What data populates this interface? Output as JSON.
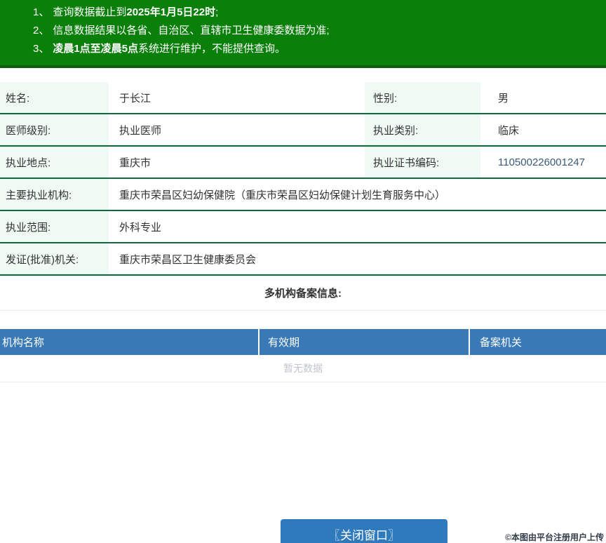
{
  "notice": {
    "items": [
      {
        "num": "1、",
        "pre": "查询数据截止到",
        "bold": "2025年1月5日22时",
        "post": ";"
      },
      {
        "num": "2、",
        "pre": "信息数据结果以各省、自治区、直辖市卫生健康委数据为准;",
        "bold": "",
        "post": ""
      },
      {
        "num": "3、",
        "pre": "",
        "bold": "凌晨1点至凌晨5点",
        "post": "系统进行维护，不能提供查询。"
      }
    ]
  },
  "info_rows": [
    {
      "l1": "姓名:",
      "v1": "于长江",
      "l2": "性别:",
      "v2": "男"
    },
    {
      "l1": "医师级别:",
      "v1": "执业医师",
      "l2": "执业类别:",
      "v2": "临床"
    },
    {
      "l1": "执业地点:",
      "v1": "重庆市",
      "l2": "执业证书编码:",
      "v2": "110500226001247"
    },
    {
      "l1": "主要执业机构:",
      "v1": "重庆市荣昌区妇幼保健院（重庆市荣昌区妇幼保健计划生育服务中心）"
    },
    {
      "l1": "执业范围:",
      "v1": "外科专业"
    },
    {
      "l1": "发证(批准)机关:",
      "v1": "重庆市荣昌区卫生健康委员会"
    }
  ],
  "section": {
    "title": "多机构备案信息:"
  },
  "record_table": {
    "headers": [
      "机构名称",
      "有效期",
      "备案机关"
    ],
    "empty_text": "暂无数据"
  },
  "footer": {
    "close_button": "〖关闭窗口〗",
    "watermark": "©本图由平台注册用户上传"
  },
  "colors": {
    "banner_green": "#0a800a",
    "banner_border_green": "#0b5e0b",
    "row_divider_green": "#0c6b3e",
    "label_mint": "#effaf4",
    "table_header_blue": "#3879b6",
    "button_blue": "#2f7abd",
    "certificate_number_blue": "#3a5a78",
    "empty_text_gray": "#c0c4cc"
  }
}
